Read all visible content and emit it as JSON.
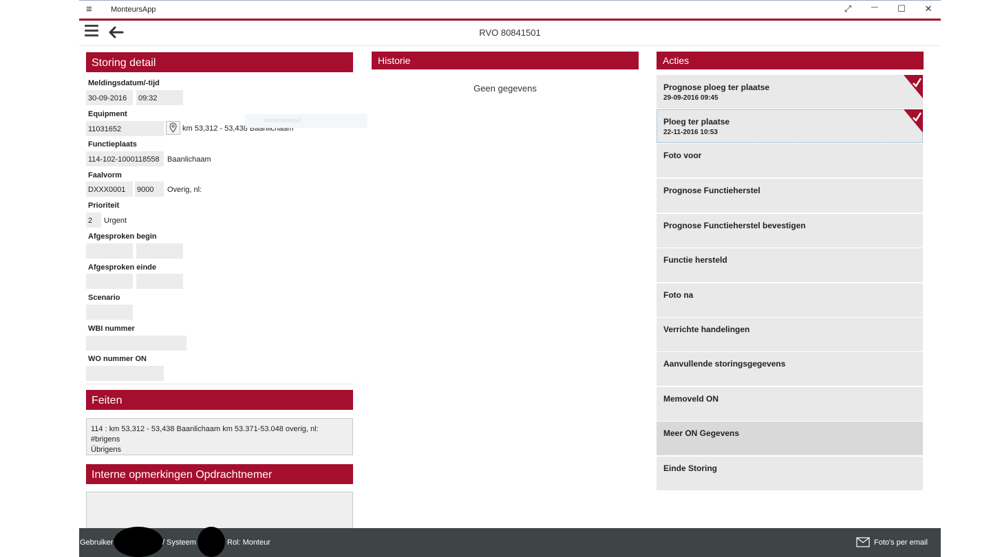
{
  "window": {
    "app_title": "MonteursApp",
    "menu_glyph": "≡",
    "btn_expand": "⤢",
    "btn_min": "—",
    "btn_max": "☐",
    "btn_close": "✕"
  },
  "appbar": {
    "title": "RVO 80841501",
    "back_glyph": "🡐"
  },
  "storing": {
    "header": "Storing detail",
    "meldingsdatum_label": "Meldingsdatum/-tijd",
    "meldingsdatum_date": "30-09-2016",
    "meldingsdatum_time": "09:32",
    "equipment_label": "Equipment",
    "equipment_value": "11031652",
    "equipment_text": "km 53,312 - 53,438 Baanlichaam",
    "equipment_ghost": "Verderkniesel",
    "functieplaats_label": "Functieplaats",
    "functieplaats_value": "114-102-1000118558",
    "functieplaats_text": "Baanlichaam",
    "faalvorm_label": "Faalvorm",
    "faalvorm_code": "DXXX0001",
    "faalvorm_num": "9000",
    "faalvorm_text": "Overig, nl:",
    "prioriteit_label": "Prioriteit",
    "prioriteit_value": "2",
    "prioriteit_text": "Urgent",
    "afgesproken_begin_label": "Afgesproken begin",
    "afgesproken_einde_label": "Afgesproken einde",
    "scenario_label": "Scenario",
    "wbi_label": "WBI nummer",
    "wo_label": "WO nummer ON"
  },
  "feiten": {
    "header": "Feiten",
    "line1": "114 : km 53,312 - 53,438 Baanlichaam km 53.371-53.048 overig, nl:",
    "line2": "#brigens",
    "line3": "Übrigens"
  },
  "interne": {
    "header": "Interne opmerkingen Opdrachtnemer"
  },
  "historie": {
    "header": "Historie",
    "empty": "Geen gegevens"
  },
  "acties": {
    "header": "Acties",
    "items": [
      {
        "label": "Prognose ploeg ter plaatse",
        "date": "29-09-2016 09:45",
        "done": true
      },
      {
        "label": "Ploeg ter plaatse",
        "date": "22-11-2016 10:53",
        "done": true
      },
      {
        "label": "Foto voor"
      },
      {
        "label": "Prognose Functieherstel"
      },
      {
        "label": "Prognose Functieherstel bevestigen"
      },
      {
        "label": "Functie hersteld"
      },
      {
        "label": "Foto na"
      },
      {
        "label": "Verrichte handelingen"
      },
      {
        "label": "Aanvullende storingsgegevens"
      },
      {
        "label": "Memoveld ON"
      },
      {
        "label": "Meer ON Gegevens"
      },
      {
        "label": "Einde Storing"
      }
    ]
  },
  "statusbar": {
    "gebruiker": "Gebruiker",
    "systeem": "/ Systeem",
    "rol": "Rol: Monteur",
    "email": "Foto's per email"
  },
  "colors": {
    "accent": "#a50e2d",
    "statusbar": "#3f4547",
    "field_bg": "#ececec"
  }
}
